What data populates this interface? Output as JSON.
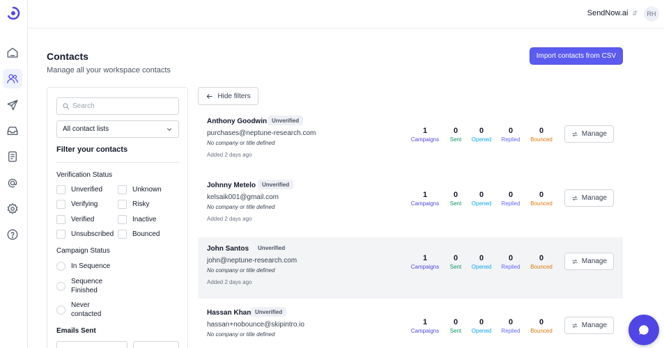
{
  "workspace": {
    "name": "SendNow.ai",
    "avatar_initials": "RH"
  },
  "nav": {
    "items": [
      "home-icon",
      "contacts-icon",
      "send-icon",
      "inbox-icon",
      "templates-icon",
      "at-sign-icon",
      "settings-icon",
      "help-icon"
    ],
    "active": "contacts-icon"
  },
  "header": {
    "title": "Contacts",
    "subtitle": "Manage all your workspace contacts",
    "import_label": "Import contacts from CSV"
  },
  "filters": {
    "search_placeholder": "Search",
    "list_selected": "All contact lists",
    "title": "Filter your contacts",
    "verification_heading": "Verification Status",
    "verification_options": [
      "Unverified",
      "Unknown",
      "Verifying",
      "Risky",
      "Verified",
      "Inactive",
      "Unsubscribed",
      "Bounced"
    ],
    "campaign_heading": "Campaign Status",
    "campaign_options": [
      "In Sequence",
      "Sequence Finished",
      "Never contacted"
    ],
    "emails_sent_heading": "Emails Sent"
  },
  "hide_filters_label": "Hide filters",
  "stat_labels": {
    "campaigns": "Campaigns",
    "sent": "Sent",
    "opened": "Opened",
    "replied": "Replied",
    "bounced": "Bounced"
  },
  "manage_label": "Manage",
  "contacts": [
    {
      "name": "Anthony Goodwin",
      "status": "Unverified",
      "email": "purchases@neptune-research.com",
      "company": "No company or title defined",
      "added": "Added 2 days ago",
      "campaigns": 1,
      "sent": 0,
      "opened": 0,
      "replied": 0,
      "bounced": 0
    },
    {
      "name": "Johnny Metelo",
      "status": "Unverified",
      "email": "kelsaik001@gmail.com",
      "company": "No company or title defined",
      "added": "Added 2 days ago",
      "campaigns": 1,
      "sent": 0,
      "opened": 0,
      "replied": 0,
      "bounced": 0
    },
    {
      "name": "John Santos",
      "status": "Unverified",
      "email": "john@neptune-research.com",
      "company": "No company or title defined",
      "added": "Added 2 days ago",
      "campaigns": 1,
      "sent": 0,
      "opened": 0,
      "replied": 0,
      "bounced": 0
    },
    {
      "name": "Hassan Khan",
      "status": "Unverified",
      "email": "hassan+nobounce@skipintro.io",
      "company": "No company or title defined",
      "added": "",
      "campaigns": 1,
      "sent": 0,
      "opened": 0,
      "replied": 0,
      "bounced": 0
    }
  ],
  "colors": {
    "accent": "#5b5bf0",
    "campaigns": "#4f46e5",
    "sent": "#059669",
    "opened": "#0ea5e9",
    "replied": "#6366f1",
    "bounced": "#d97706"
  }
}
